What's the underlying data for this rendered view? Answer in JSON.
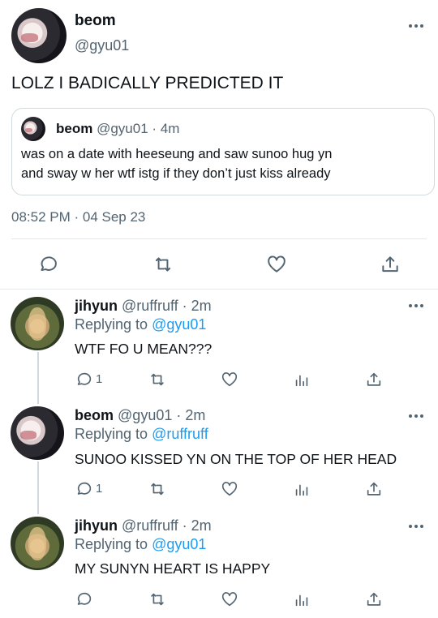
{
  "main_tweet": {
    "name": "beom",
    "handle": "@gyu01",
    "text": "LOLZ I BADICALLY PREDICTED IT",
    "quote": {
      "name": "beom",
      "handle": "@gyu01",
      "time": "· 4m",
      "line1": "was on a date with heeseung and saw sunoo hug yn",
      "line2": "and sway w her wtf istg if they don’t just kiss already"
    },
    "timestamp": "08:52 PM · 04 Sep 23"
  },
  "replies": [
    {
      "name": "jihyun",
      "handle": "@ruffruff",
      "time": "· 2m",
      "replying_label": "Replying to",
      "replying_to": "@gyu01",
      "text": "WTF FO U MEAN???",
      "reply_count": "1"
    },
    {
      "name": "beom",
      "handle": "@gyu01",
      "time": "· 2m",
      "replying_label": "Replying to",
      "replying_to": "@ruffruff",
      "text": "SUNOO KISSED YN ON THE TOP OF HER HEAD",
      "reply_count": "1"
    },
    {
      "name": "jihyun",
      "handle": "@ruffruff",
      "time": "· 2m",
      "replying_label": "Replying to",
      "replying_to": "@gyu01",
      "text": "MY SUNYN HEART IS HAPPY",
      "reply_count": ""
    }
  ],
  "icons": {
    "more": "more-icon",
    "reply": "reply-icon",
    "retweet": "retweet-icon",
    "like": "heart-icon",
    "views": "views-icon",
    "share": "share-icon"
  },
  "colors": {
    "link": "#1d9bf0",
    "secondary": "#536471",
    "primary": "#0f1419"
  }
}
